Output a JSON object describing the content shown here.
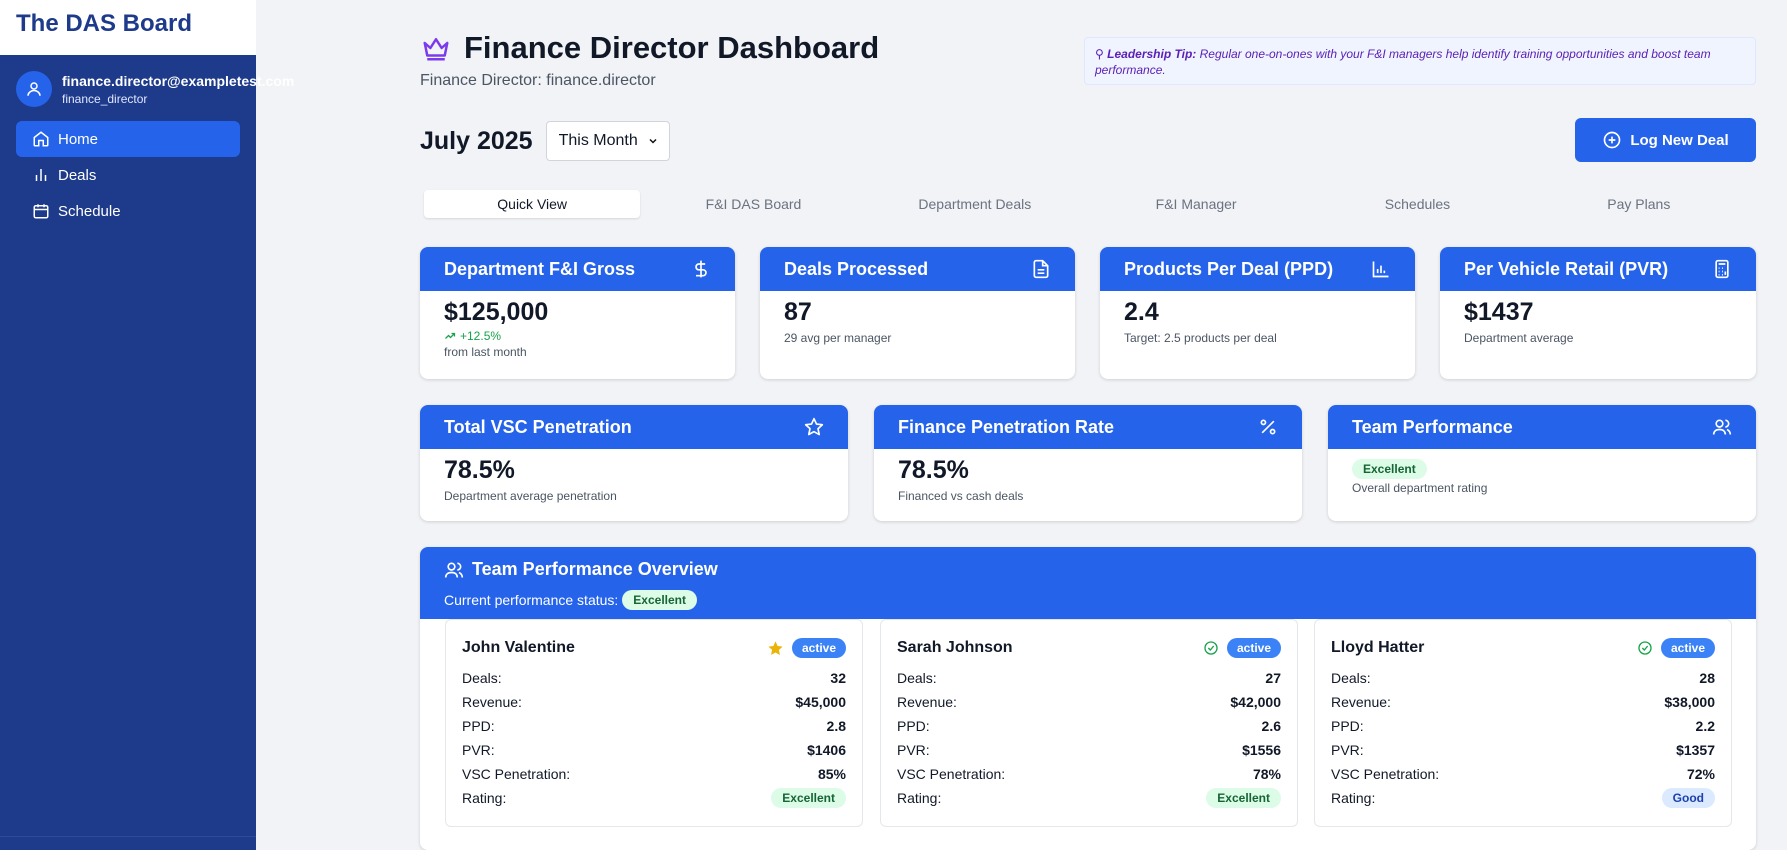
{
  "brand": "The DAS Board",
  "user": {
    "email": "finance.director@exampletest.com",
    "role": "finance_director"
  },
  "nav": [
    {
      "label": "Home",
      "icon": "home-icon",
      "active": true
    },
    {
      "label": "Deals",
      "icon": "bar-chart-icon",
      "active": false
    },
    {
      "label": "Schedule",
      "icon": "calendar-icon",
      "active": false
    }
  ],
  "header": {
    "title": "Finance Director Dashboard",
    "subtitle": "Finance Director: finance.director",
    "icon": "crown-icon"
  },
  "tip": {
    "label": "Leadership Tip:",
    "text": "Regular one-on-ones with your F&I managers help identify training opportunities and boost team performance."
  },
  "period": {
    "label": "July 2025",
    "select_value": "This Month"
  },
  "log_button": "Log New Deal",
  "tabs": [
    "Quick View",
    "F&I DAS Board",
    "Department Deals",
    "F&I Manager",
    "Schedules",
    "Pay Plans"
  ],
  "metrics": {
    "gross": {
      "title": "Department F&I Gross",
      "value": "$125,000",
      "trend": "+12.5%",
      "note": "from last month"
    },
    "deals": {
      "title": "Deals Processed",
      "value": "87",
      "note": "29 avg per manager"
    },
    "ppd": {
      "title": "Products Per Deal (PPD)",
      "value": "2.4",
      "note": "Target: 2.5 products per deal"
    },
    "pvr": {
      "title": "Per Vehicle Retail (PVR)",
      "value": "$1437",
      "note": "Department average"
    },
    "vsc": {
      "title": "Total VSC Penetration",
      "value": "78.5%",
      "note": "Department average penetration"
    },
    "finance": {
      "title": "Finance Penetration Rate",
      "value": "78.5%",
      "note": "Financed vs cash deals"
    },
    "team": {
      "title": "Team Performance",
      "badge": "Excellent",
      "note": "Overall department rating"
    }
  },
  "overview": {
    "title": "Team Performance Overview",
    "status_label": "Current performance status:",
    "status_badge": "Excellent",
    "labels": {
      "deals": "Deals:",
      "revenue": "Revenue:",
      "ppd": "PPD:",
      "pvr": "PVR:",
      "vsc": "VSC Penetration:",
      "rating": "Rating:"
    },
    "managers": [
      {
        "name": "John Valentine",
        "status": "active",
        "icon": "star-icon",
        "deals": "32",
        "revenue": "$45,000",
        "ppd": "2.8",
        "pvr": "$1406",
        "vsc": "85%",
        "rating": "Excellent"
      },
      {
        "name": "Sarah Johnson",
        "status": "active",
        "icon": "check-circle-icon",
        "deals": "27",
        "revenue": "$42,000",
        "ppd": "2.6",
        "pvr": "$1556",
        "vsc": "78%",
        "rating": "Excellent"
      },
      {
        "name": "Lloyd Hatter",
        "status": "active",
        "icon": "check-circle-icon",
        "deals": "28",
        "revenue": "$38,000",
        "ppd": "2.2",
        "pvr": "$1357",
        "vsc": "72%",
        "rating": "Good"
      }
    ]
  },
  "colors": {
    "primary": "#2563eb",
    "sidebar": "#1e3a8a",
    "accent_purple": "#7c3aed",
    "success": "#16a34a",
    "star": "#eab308"
  }
}
